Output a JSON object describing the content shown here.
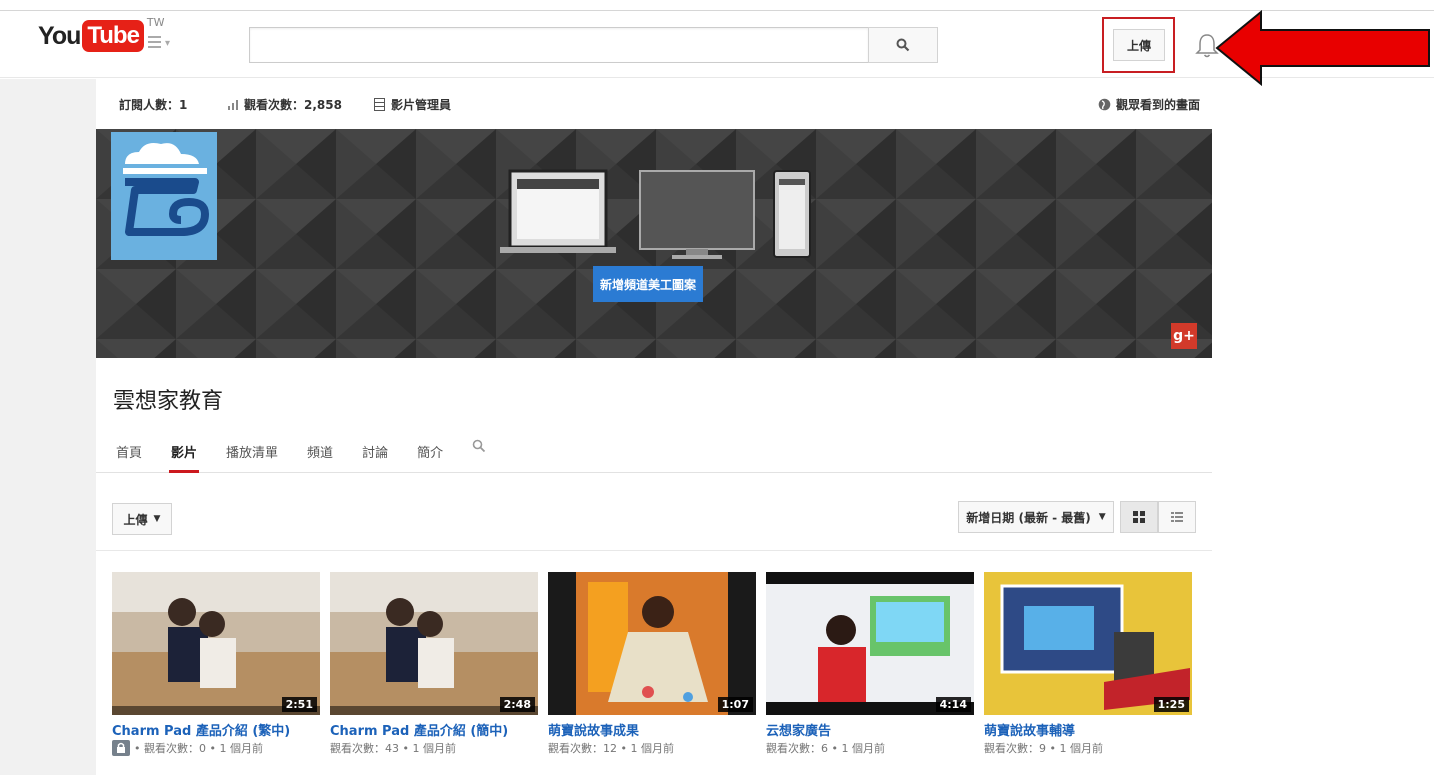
{
  "header": {
    "logo_you": "You",
    "logo_tube": "Tube",
    "region": "TW",
    "search_placeholder": "",
    "upload_label": "上傳"
  },
  "stats": {
    "subscribers": "訂閱人數：1",
    "views": "觀看次數：2,858",
    "video_manager": "影片管理員",
    "view_as": "觀眾看到的畫面"
  },
  "banner": {
    "add_art_label": "新增頻道美工圖案",
    "gplus_label": "g+"
  },
  "channel": {
    "title": "雲想家教育",
    "tabs": [
      {
        "label": "首頁"
      },
      {
        "label": "影片"
      },
      {
        "label": "播放清單"
      },
      {
        "label": "頻道"
      },
      {
        "label": "討論"
      },
      {
        "label": "簡介"
      }
    ]
  },
  "toolbar": {
    "upload_dropdown": "上傳",
    "sort_label": "新增日期 (最新 - 最舊)"
  },
  "videos": [
    {
      "title": "Charm Pad 產品介紹 (繁中)",
      "meta": "• 觀看次數：0 • 1 個月前",
      "duration": "2:51",
      "private": true
    },
    {
      "title": "Charm Pad 產品介紹 (簡中)",
      "meta": "觀看次數：43 • 1 個月前",
      "duration": "2:48",
      "private": false
    },
    {
      "title": "萌寶說故事成果",
      "meta": "觀看次數：12 • 1 個月前",
      "duration": "1:07",
      "private": false
    },
    {
      "title": "云想家廣告",
      "meta": "觀看次數：6 • 1 個月前",
      "duration": "4:14",
      "private": false
    },
    {
      "title": "萌寶說故事輔導",
      "meta": "觀看次數：9 • 1 個月前",
      "duration": "1:25",
      "private": false
    }
  ],
  "colors": {
    "brand_red": "#e62117",
    "link_blue": "#1c62b9",
    "accent_blue": "#2b7bd3",
    "highlight_red": "#c81e22",
    "arrow_red": "#e80000"
  }
}
